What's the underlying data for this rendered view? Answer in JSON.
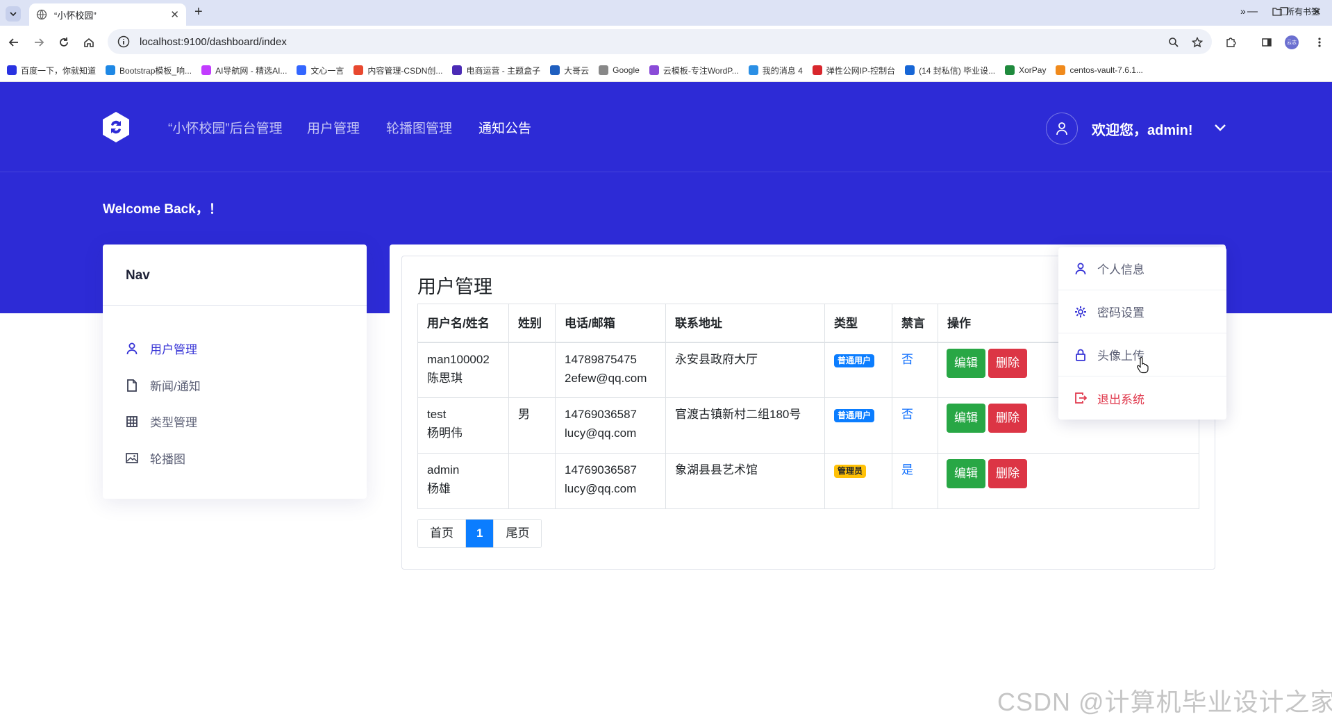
{
  "browser": {
    "tab_title": "“小怀校园”",
    "url": "localhost:9100/dashboard/index",
    "bookmarks": [
      {
        "label": "百度一下，你就知道",
        "color": "#2932e1"
      },
      {
        "label": "Bootstrap模板_响...",
        "color": "#1e88e5"
      },
      {
        "label": "AI导航网 - 精选AI...",
        "color": "#c23cff"
      },
      {
        "label": "文心一言",
        "color": "#3366ff"
      },
      {
        "label": "内容管理-CSDN创...",
        "color": "#e8482f"
      },
      {
        "label": "电商运营 - 主题盒子",
        "color": "#4b2bb5"
      },
      {
        "label": "大哥云",
        "color": "#1f5fbf"
      },
      {
        "label": "Google",
        "color": "#888888"
      },
      {
        "label": "云模板-专注WordP...",
        "color": "#8a4bd8"
      },
      {
        "label": "我的消息 4",
        "color": "#2a8fe5"
      },
      {
        "label": "弹性公网IP-控制台",
        "color": "#d8272d"
      },
      {
        "label": "(14 封私信) 毕业设...",
        "color": "#1766d6"
      },
      {
        "label": "XorPay",
        "color": "#1f8a3d"
      },
      {
        "label": "centos-vault-7.6.1...",
        "color": "#f08a1c"
      }
    ],
    "all_bookmarks": "所有书签",
    "profile_badge": "云志"
  },
  "header": {
    "brand": "“小怀校园”后台管理",
    "nav": [
      "用户管理",
      "轮播图管理",
      "通知公告"
    ],
    "welcome_user": "欢迎您，admin!"
  },
  "hero": {
    "welcome_back": "Welcome Back，！"
  },
  "sidebar": {
    "title": "Nav",
    "items": [
      {
        "label": "用户管理",
        "icon": "user-icon"
      },
      {
        "label": "新闻/通知",
        "icon": "file-icon"
      },
      {
        "label": "类型管理",
        "icon": "grid-icon"
      },
      {
        "label": "轮播图",
        "icon": "image-icon"
      }
    ]
  },
  "content": {
    "title": "用户管理",
    "columns": [
      "用户名/姓名",
      "姓别",
      "电话/邮箱",
      "联系地址",
      "类型",
      "禁言",
      "操作"
    ],
    "rows": [
      {
        "username": "man100002",
        "name": "陈思琪",
        "gender": "",
        "phone": "14789875475",
        "email": "2efew@qq.com",
        "address": "永安县政府大厅",
        "type": "普通用户",
        "type_kind": "user",
        "banned": "否"
      },
      {
        "username": "test",
        "name": "杨明伟",
        "gender": "男",
        "phone": "14769036587",
        "email": "lucy@qq.com",
        "address": "官渡古镇新村二组180号",
        "type": "普通用户",
        "type_kind": "user",
        "banned": "否"
      },
      {
        "username": "admin",
        "name": "杨雄",
        "gender": "",
        "phone": "14769036587",
        "email": "lucy@qq.com",
        "address": "象湖县县艺术馆",
        "type": "管理员",
        "type_kind": "admin",
        "banned": "是"
      }
    ],
    "edit_label": "编辑",
    "delete_label": "删除",
    "pager": {
      "first": "首页",
      "current": "1",
      "last": "尾页"
    }
  },
  "dropdown": {
    "items": [
      {
        "label": "个人信息",
        "icon": "user-icon"
      },
      {
        "label": "密码设置",
        "icon": "gear-icon"
      },
      {
        "label": "头像上传",
        "icon": "lock-icon"
      },
      {
        "label": "退出系统",
        "icon": "logout-icon"
      }
    ]
  },
  "watermark": "CSDN @计算机毕业设计之家",
  "colors": {
    "brand": "#2d2bd6",
    "edit": "#28a745",
    "delete": "#dc3545",
    "primary": "#0b7dff"
  }
}
